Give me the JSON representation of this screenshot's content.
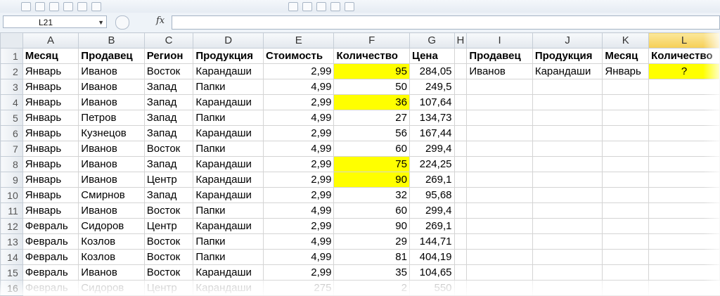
{
  "name_box": {
    "value": "L21"
  },
  "formula_bar": {
    "fx_label": "fx",
    "value": ""
  },
  "columns": [
    "A",
    "B",
    "C",
    "D",
    "E",
    "F",
    "G",
    "H",
    "I",
    "J",
    "K",
    "L"
  ],
  "selected_column": "L",
  "rows": [
    [
      "Месяц",
      "Продавец",
      "Регион",
      "Продукция",
      "Стоимость",
      "Количество",
      "Цена",
      "",
      "Продавец",
      "Продукция",
      "Месяц",
      "Количество"
    ],
    [
      "Январь",
      "Иванов",
      "Восток",
      "Карандаши",
      "2,99",
      "95",
      "284,05",
      "",
      "Иванов",
      "Карандаши",
      "Январь",
      "?"
    ],
    [
      "Январь",
      "Иванов",
      "Запад",
      "Папки",
      "4,99",
      "50",
      "249,5",
      "",
      "",
      "",
      "",
      ""
    ],
    [
      "Январь",
      "Иванов",
      "Запад",
      "Карандаши",
      "2,99",
      "36",
      "107,64",
      "",
      "",
      "",
      "",
      ""
    ],
    [
      "Январь",
      "Петров",
      "Запад",
      "Папки",
      "4,99",
      "27",
      "134,73",
      "",
      "",
      "",
      "",
      ""
    ],
    [
      "Январь",
      "Кузнецов",
      "Запад",
      "Карандаши",
      "2,99",
      "56",
      "167,44",
      "",
      "",
      "",
      "",
      ""
    ],
    [
      "Январь",
      "Иванов",
      "Восток",
      "Папки",
      "4,99",
      "60",
      "299,4",
      "",
      "",
      "",
      "",
      ""
    ],
    [
      "Январь",
      "Иванов",
      "Запад",
      "Карандаши",
      "2,99",
      "75",
      "224,25",
      "",
      "",
      "",
      "",
      ""
    ],
    [
      "Январь",
      "Иванов",
      "Центр",
      "Карандаши",
      "2,99",
      "90",
      "269,1",
      "",
      "",
      "",
      "",
      ""
    ],
    [
      "Январь",
      "Смирнов",
      "Запад",
      "Карандаши",
      "2,99",
      "32",
      "95,68",
      "",
      "",
      "",
      "",
      ""
    ],
    [
      "Январь",
      "Иванов",
      "Восток",
      "Папки",
      "4,99",
      "60",
      "299,4",
      "",
      "",
      "",
      "",
      ""
    ],
    [
      "Февраль",
      "Сидоров",
      "Центр",
      "Карандаши",
      "2,99",
      "90",
      "269,1",
      "",
      "",
      "",
      "",
      ""
    ],
    [
      "Февраль",
      "Козлов",
      "Восток",
      "Папки",
      "4,99",
      "29",
      "144,71",
      "",
      "",
      "",
      "",
      ""
    ],
    [
      "Февраль",
      "Козлов",
      "Восток",
      "Папки",
      "4,99",
      "81",
      "404,19",
      "",
      "",
      "",
      "",
      ""
    ],
    [
      "Февраль",
      "Иванов",
      "Восток",
      "Карандаши",
      "2,99",
      "35",
      "104,65",
      "",
      "",
      "",
      "",
      ""
    ],
    [
      "Февраль",
      "Сидоров",
      "Центр",
      "Карандаши",
      "275",
      "2",
      "550",
      "",
      "",
      "",
      "",
      ""
    ]
  ],
  "highlighted_cells": [
    "F2",
    "F4",
    "F8",
    "F9",
    "L2"
  ],
  "colors": {
    "highlight": "#ffff00",
    "selected_header": "#f6cf55"
  }
}
